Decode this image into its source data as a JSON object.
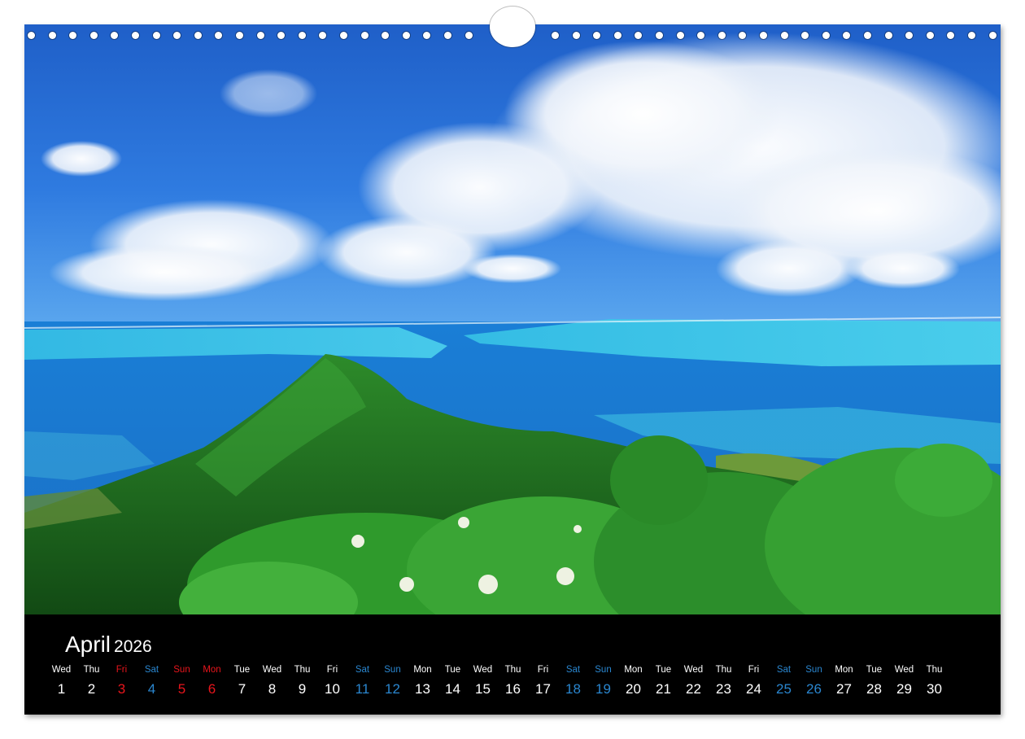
{
  "calendar": {
    "month": "April",
    "year": "2026"
  },
  "days": [
    {
      "wd": "Wed",
      "d": "1",
      "kind": "normal"
    },
    {
      "wd": "Thu",
      "d": "2",
      "kind": "normal"
    },
    {
      "wd": "Fri",
      "d": "3",
      "kind": "holiday"
    },
    {
      "wd": "Sat",
      "d": "4",
      "kind": "weekend"
    },
    {
      "wd": "Sun",
      "d": "5",
      "kind": "holiday"
    },
    {
      "wd": "Mon",
      "d": "6",
      "kind": "holiday"
    },
    {
      "wd": "Tue",
      "d": "7",
      "kind": "normal"
    },
    {
      "wd": "Wed",
      "d": "8",
      "kind": "normal"
    },
    {
      "wd": "Thu",
      "d": "9",
      "kind": "normal"
    },
    {
      "wd": "Fri",
      "d": "10",
      "kind": "normal"
    },
    {
      "wd": "Sat",
      "d": "11",
      "kind": "weekend"
    },
    {
      "wd": "Sun",
      "d": "12",
      "kind": "weekend"
    },
    {
      "wd": "Mon",
      "d": "13",
      "kind": "normal"
    },
    {
      "wd": "Tue",
      "d": "14",
      "kind": "normal"
    },
    {
      "wd": "Wed",
      "d": "15",
      "kind": "normal"
    },
    {
      "wd": "Thu",
      "d": "16",
      "kind": "normal"
    },
    {
      "wd": "Fri",
      "d": "17",
      "kind": "normal"
    },
    {
      "wd": "Sat",
      "d": "18",
      "kind": "weekend"
    },
    {
      "wd": "Sun",
      "d": "19",
      "kind": "weekend"
    },
    {
      "wd": "Mon",
      "d": "20",
      "kind": "normal"
    },
    {
      "wd": "Tue",
      "d": "21",
      "kind": "normal"
    },
    {
      "wd": "Wed",
      "d": "22",
      "kind": "normal"
    },
    {
      "wd": "Thu",
      "d": "23",
      "kind": "normal"
    },
    {
      "wd": "Fri",
      "d": "24",
      "kind": "normal"
    },
    {
      "wd": "Sat",
      "d": "25",
      "kind": "weekend"
    },
    {
      "wd": "Sun",
      "d": "26",
      "kind": "weekend"
    },
    {
      "wd": "Mon",
      "d": "27",
      "kind": "normal"
    },
    {
      "wd": "Tue",
      "d": "28",
      "kind": "normal"
    },
    {
      "wd": "Wed",
      "d": "29",
      "kind": "normal"
    },
    {
      "wd": "Thu",
      "d": "30",
      "kind": "normal"
    }
  ],
  "colors": {
    "strip_background": "#000000",
    "normal_day": "#ffffff",
    "weekend_day": "#2a86cf",
    "holiday_day": "#e8151c"
  },
  "photo": {
    "icon": "landscape-photo"
  }
}
